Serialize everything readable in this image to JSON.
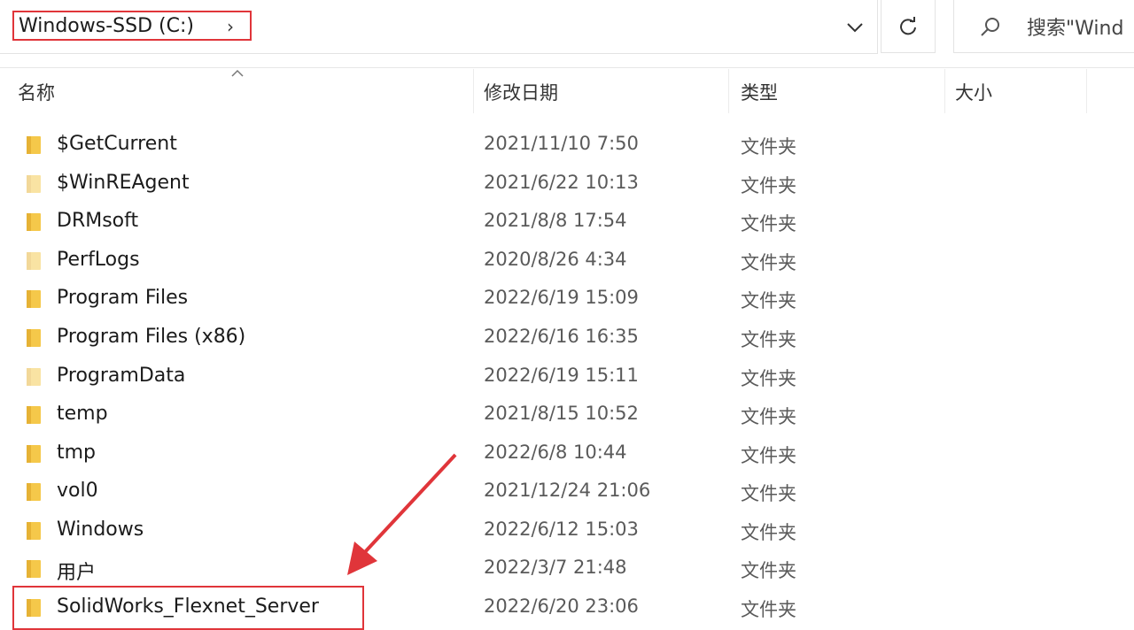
{
  "address": {
    "path_label": "Windows-SSD (C:)",
    "chevron": "›"
  },
  "search": {
    "placeholder": "搜索\"Windows-SSD (C:)\"",
    "text": "搜索\"Wind"
  },
  "columns": {
    "name": "名称",
    "modified": "修改日期",
    "type": "类型",
    "size": "大小"
  },
  "rows": [
    {
      "name": "$GetCurrent",
      "date": "2021/11/10 7:50",
      "type": "文件夹"
    },
    {
      "name": "$WinREAgent",
      "date": "2021/6/22 10:13",
      "type": "文件夹"
    },
    {
      "name": "DRMsoft",
      "date": "2021/8/8 17:54",
      "type": "文件夹"
    },
    {
      "name": "PerfLogs",
      "date": "2020/8/26 4:34",
      "type": "文件夹"
    },
    {
      "name": "Program Files",
      "date": "2022/6/19 15:09",
      "type": "文件夹"
    },
    {
      "name": "Program Files (x86)",
      "date": "2022/6/16 16:35",
      "type": "文件夹"
    },
    {
      "name": "ProgramData",
      "date": "2022/6/19 15:11",
      "type": "文件夹"
    },
    {
      "name": "temp",
      "date": "2021/8/15 10:52",
      "type": "文件夹"
    },
    {
      "name": "tmp",
      "date": "2022/6/8 10:44",
      "type": "文件夹"
    },
    {
      "name": "vol0",
      "date": "2021/12/24 21:06",
      "type": "文件夹"
    },
    {
      "name": "Windows",
      "date": "2022/6/12 15:03",
      "type": "文件夹"
    },
    {
      "name": "用户",
      "date": "2022/3/7 21:48",
      "type": "文件夹"
    },
    {
      "name": "SolidWorks_Flexnet_Server",
      "date": "2022/6/20 23:06",
      "type": "文件夹"
    }
  ],
  "icons": {
    "folder": "folder-icon",
    "refresh": "refresh-icon",
    "search": "search-icon",
    "dropdown": "chevron-down-icon",
    "sort": "sort-up-icon"
  },
  "colors": {
    "annotation_red": "#e0353a",
    "folder_yellow": "#f5c84a"
  }
}
